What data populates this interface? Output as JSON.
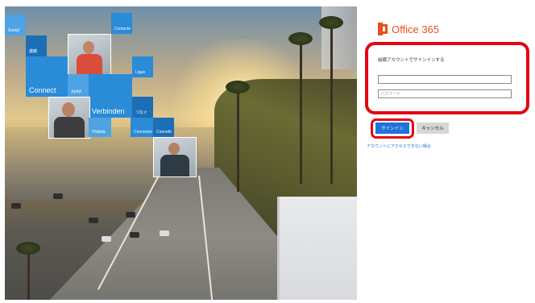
{
  "hero": {
    "tiles": {
      "t1": "Suniq!",
      "t2": "Contacte",
      "t3": "連絡",
      "t4": "Ligue",
      "t5": "Connect",
      "t6": "Juntý!",
      "t7": "Verbinden",
      "t8": "つなぐ",
      "t9": "Yhdistä",
      "t10": "Connecter",
      "t11": "Connetti"
    }
  },
  "brand": {
    "name": "Office 365",
    "color": "#e8501d",
    "logo_icon": "office-logo-icon"
  },
  "form": {
    "prompt": "組織アカウントでサインインする",
    "username_value": "",
    "username_placeholder": "",
    "password_placeholder": "パスワード",
    "signin_label": "サインイン",
    "cancel_label": "キャンセル",
    "help_link": "アカウントにアクセスできない場合"
  },
  "colors": {
    "accent": "#1f72d6",
    "highlight": "#e30613",
    "tile": "#2a8bd6"
  }
}
